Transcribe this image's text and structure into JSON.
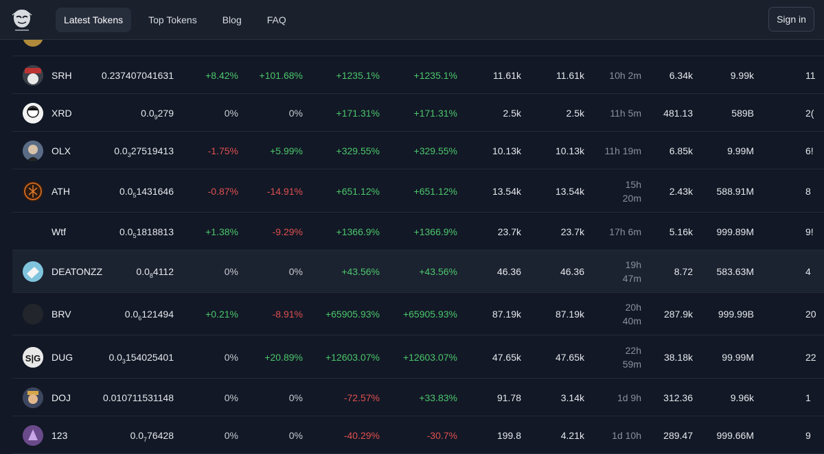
{
  "header": {
    "nav": [
      "Latest Tokens",
      "Top Tokens",
      "Blog",
      "FAQ"
    ],
    "signin": "Sign in"
  },
  "rows": [
    {
      "sym": "SRH",
      "p_pre": "0.237407041631",
      "p_sub": "",
      "p_post": "",
      "c1": "+8.42%",
      "c2": "+101.68%",
      "c3": "+1235.1%",
      "c4": "+1235.1%",
      "v1": "11.61k",
      "v2": "11.61k",
      "age": "10h 2m",
      "v3": "6.34k",
      "supply": "9.99k",
      "edge": "11"
    },
    {
      "sym": "XRD",
      "p_pre": "0.0",
      "p_sub": "9",
      "p_post": "279",
      "c1": "0%",
      "c2": "0%",
      "c3": "+171.31%",
      "c4": "+171.31%",
      "v1": "2.5k",
      "v2": "2.5k",
      "age": "11h 5m",
      "v3": "481.13",
      "supply": "589B",
      "edge": "2("
    },
    {
      "sym": "OLX",
      "p_pre": "0.0",
      "p_sub": "3",
      "p_post": "27519413",
      "c1": "-1.75%",
      "c2": "+5.99%",
      "c3": "+329.55%",
      "c4": "+329.55%",
      "v1": "10.13k",
      "v2": "10.13k",
      "age": "11h 19m",
      "v3": "6.85k",
      "supply": "9.99M",
      "edge": "6!"
    },
    {
      "sym": "ATH",
      "p_pre": "0.0",
      "p_sub": "5",
      "p_post": "1431646",
      "c1": "-0.87%",
      "c2": "-14.91%",
      "c3": "+651.12%",
      "c4": "+651.12%",
      "v1": "13.54k",
      "v2": "13.54k",
      "age_a": "15h",
      "age_b": "20m",
      "v3": "2.43k",
      "supply": "588.91M",
      "edge": "8"
    },
    {
      "sym": "Wtf",
      "p_pre": "0.0",
      "p_sub": "5",
      "p_post": "1818813",
      "c1": "+1.38%",
      "c2": "-9.29%",
      "c3": "+1366.9%",
      "c4": "+1366.9%",
      "v1": "23.7k",
      "v2": "23.7k",
      "age": "17h 6m",
      "v3": "5.16k",
      "supply": "999.89M",
      "edge": "9!"
    },
    {
      "sym": "DEATONZZ",
      "p_pre": "0.0",
      "p_sub": "8",
      "p_post": "4112",
      "c1": "0%",
      "c2": "0%",
      "c3": "+43.56%",
      "c4": "+43.56%",
      "v1": "46.36",
      "v2": "46.36",
      "age_a": "19h",
      "age_b": "47m",
      "v3": "8.72",
      "supply": "583.63M",
      "edge": "4"
    },
    {
      "sym": "BRV",
      "p_pre": "0.0",
      "p_sub": "6",
      "p_post": "121494",
      "c1": "+0.21%",
      "c2": "-8.91%",
      "c3": "+65905.93%",
      "c4": "+65905.93%",
      "v1": "87.19k",
      "v2": "87.19k",
      "age_a": "20h",
      "age_b": "40m",
      "v3": "287.9k",
      "supply": "999.99B",
      "edge": "20"
    },
    {
      "sym": "DUG",
      "p_pre": "0.0",
      "p_sub": "3",
      "p_post": "154025401",
      "c1": "0%",
      "c2": "+20.89%",
      "c3": "+12603.07%",
      "c4": "+12603.07%",
      "v1": "47.65k",
      "v2": "47.65k",
      "age_a": "22h",
      "age_b": "59m",
      "v3": "38.18k",
      "supply": "99.99M",
      "edge": "22"
    },
    {
      "sym": "DOJ",
      "p_pre": "0.010711531148",
      "p_sub": "",
      "p_post": "",
      "c1": "0%",
      "c2": "0%",
      "c3": "-72.57%",
      "c4": "+33.83%",
      "v1": "91.78",
      "v2": "3.14k",
      "age": "1d 9h",
      "v3": "312.36",
      "supply": "9.96k",
      "edge": "1"
    },
    {
      "sym": "123",
      "p_pre": "0.0",
      "p_sub": "7",
      "p_post": "76428",
      "c1": "0%",
      "c2": "0%",
      "c3": "-40.29%",
      "c4": "-30.7%",
      "v1": "199.8",
      "v2": "4.21k",
      "age": "1d 10h",
      "v3": "289.47",
      "supply": "999.66M",
      "edge": "9"
    }
  ],
  "colors": {
    "pos": "#4cc76b",
    "neg": "#e0504f",
    "bg": "#121826",
    "header": "#1a202c"
  }
}
